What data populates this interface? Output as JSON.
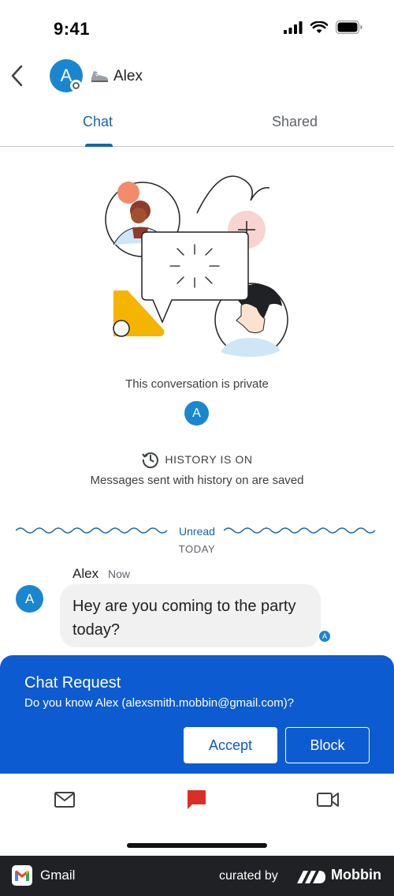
{
  "status_bar": {
    "time": "9:41"
  },
  "header": {
    "back_icon": "chevron-left-icon",
    "avatar_initial": "A",
    "status_emoji_icon": "running-shoe-icon",
    "contact_name": "Alex"
  },
  "tabs": [
    {
      "label": "Chat",
      "active": true
    },
    {
      "label": "Shared",
      "active": false
    }
  ],
  "intro": {
    "private_text": "This conversation is private",
    "avatar_initial": "A",
    "history_icon": "clock-history-icon",
    "history_label": "HISTORY IS ON",
    "history_sub": "Messages sent with history on are saved"
  },
  "divider": {
    "unread_label": "Unread",
    "date_label": "TODAY"
  },
  "messages": [
    {
      "sender": "Alex",
      "time": "Now",
      "avatar_initial": "A",
      "text": "Hey are you coming to the party today?",
      "read_receipt_initial": "A"
    }
  ],
  "chat_request": {
    "title": "Chat Request",
    "question": "Do you know Alex (alexsmith.mobbin@gmail.com)?",
    "accept_label": "Accept",
    "block_label": "Block"
  },
  "bottom_nav": [
    {
      "icon": "mail-icon",
      "active": false
    },
    {
      "icon": "chat-icon",
      "active": true
    },
    {
      "icon": "video-icon",
      "active": false
    }
  ],
  "footer": {
    "app_label": "Gmail",
    "curated_label": "curated by",
    "brand_label": "Mobbin"
  },
  "colors": {
    "accent": "#1565a8",
    "banner": "#0d5bd1",
    "avatar": "#1a86d0",
    "chat_active": "#d93025"
  }
}
